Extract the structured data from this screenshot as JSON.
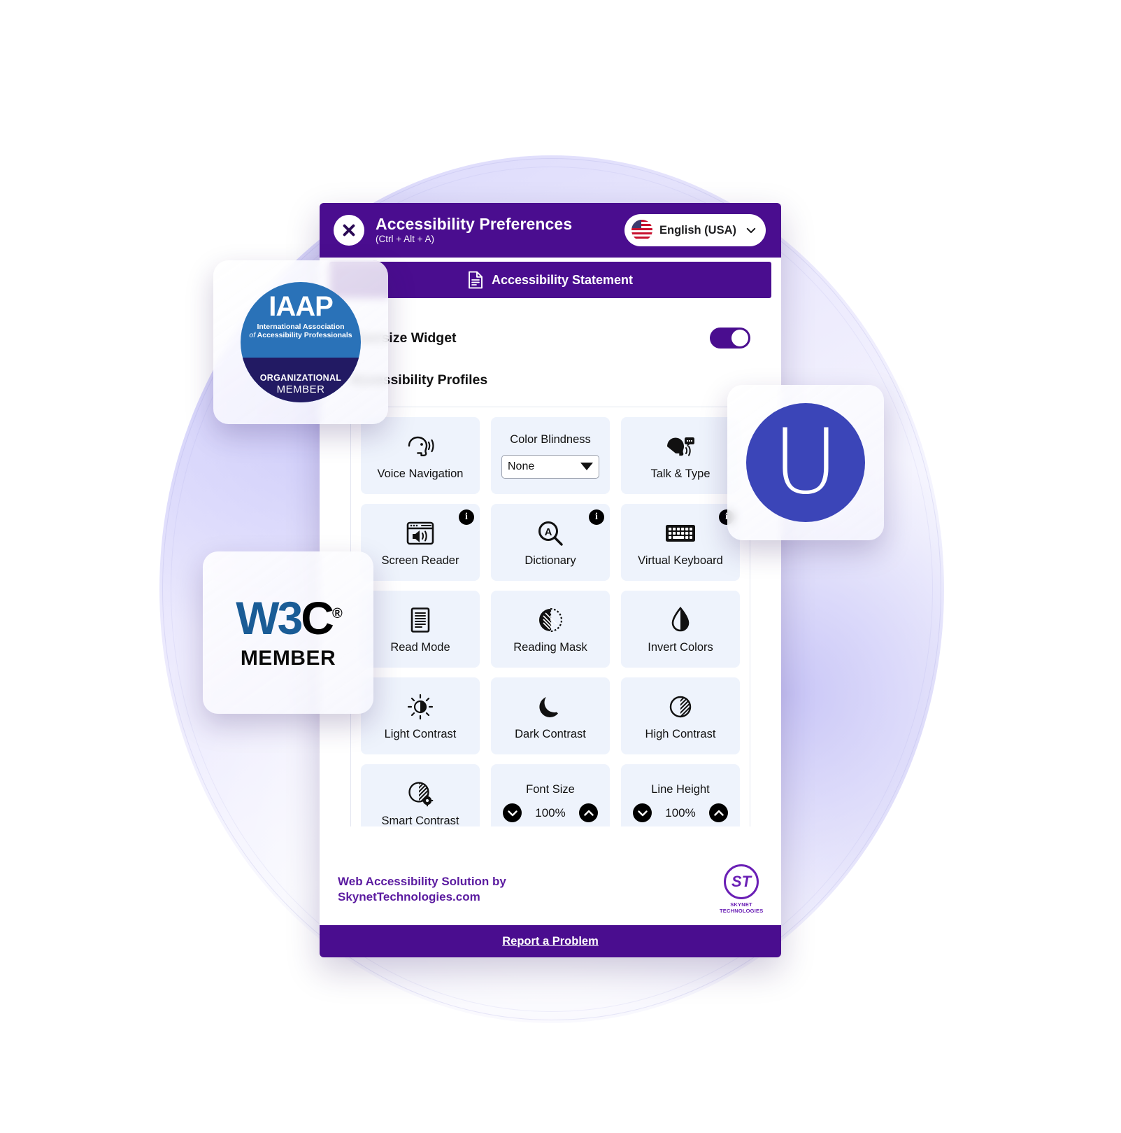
{
  "widget": {
    "header": {
      "title": "Accessibility Preferences",
      "shortcut": "(Ctrl + Alt + A)",
      "close_icon": "close-x-icon",
      "language": {
        "label": "English (USA)",
        "flag_icon": "usa-flag-icon",
        "chevron_icon": "chevron-down-icon"
      }
    },
    "statement_button": {
      "label": "Accessibility Statement",
      "icon": "document-icon"
    },
    "oversize_widget": {
      "label": "Oversize Widget",
      "state": "on"
    },
    "profiles_label": "Accessibility Profiles",
    "tiles": [
      {
        "label": "Voice Navigation",
        "icon": "voice-navigation-icon",
        "type": "toggle",
        "info": false
      },
      {
        "label": "Color Blindness",
        "icon": "",
        "type": "select",
        "value": "None",
        "info": false
      },
      {
        "label": "Talk & Type",
        "icon": "talk-and-type-icon",
        "type": "toggle",
        "info": false
      },
      {
        "label": "Screen Reader",
        "icon": "screen-reader-icon",
        "type": "toggle",
        "info": true
      },
      {
        "label": "Dictionary",
        "icon": "dictionary-icon",
        "type": "toggle",
        "info": true
      },
      {
        "label": "Virtual Keyboard",
        "icon": "virtual-keyboard-icon",
        "type": "toggle",
        "info": true
      },
      {
        "label": "Read Mode",
        "icon": "read-mode-icon",
        "type": "toggle",
        "info": false
      },
      {
        "label": "Reading Mask",
        "icon": "reading-mask-icon",
        "type": "toggle",
        "info": false
      },
      {
        "label": "Invert Colors",
        "icon": "invert-colors-icon",
        "type": "toggle",
        "info": false
      },
      {
        "label": "Light Contrast",
        "icon": "light-contrast-icon",
        "type": "toggle",
        "info": false
      },
      {
        "label": "Dark Contrast",
        "icon": "dark-contrast-icon",
        "type": "toggle",
        "info": false
      },
      {
        "label": "High Contrast",
        "icon": "high-contrast-icon",
        "type": "toggle",
        "info": false
      },
      {
        "label": "Smart Contrast",
        "icon": "smart-contrast-icon",
        "type": "toggle",
        "info": false
      },
      {
        "label": "Font Size",
        "icon": "",
        "type": "stepper",
        "value": "100%"
      },
      {
        "label": "Line Height",
        "icon": "",
        "type": "stepper",
        "value": "100%"
      }
    ],
    "footer": {
      "brand_line1": "Web Accessibility Solution by",
      "brand_line2": "SkynetTechnologies.com",
      "logo_mark": "ST",
      "logo_caption": "SKYNET TECHNOLOGIES"
    },
    "report_button": {
      "label": "Report a Problem"
    }
  },
  "badges": {
    "iaap": {
      "acronym": "IAAP",
      "line1": "International Association",
      "line2_italic": "of",
      "line2": "Accessibility Professionals",
      "tier": "ORGANIZATIONAL",
      "member": "MEMBER"
    },
    "w3c": {
      "w": "W3",
      "c": "C",
      "registered": "®",
      "member": "MEMBER"
    },
    "userway": {
      "glyph": "U"
    }
  },
  "colors": {
    "primary_purple": "#4a0d8f",
    "tile_bg": "#eef3fc",
    "brand_purple": "#5b1ba0",
    "iaap_blue": "#2a72b8",
    "iaap_navy": "#221a63",
    "w3c_blue": "#1a5c96",
    "userway_blue": "#3b45b8"
  }
}
